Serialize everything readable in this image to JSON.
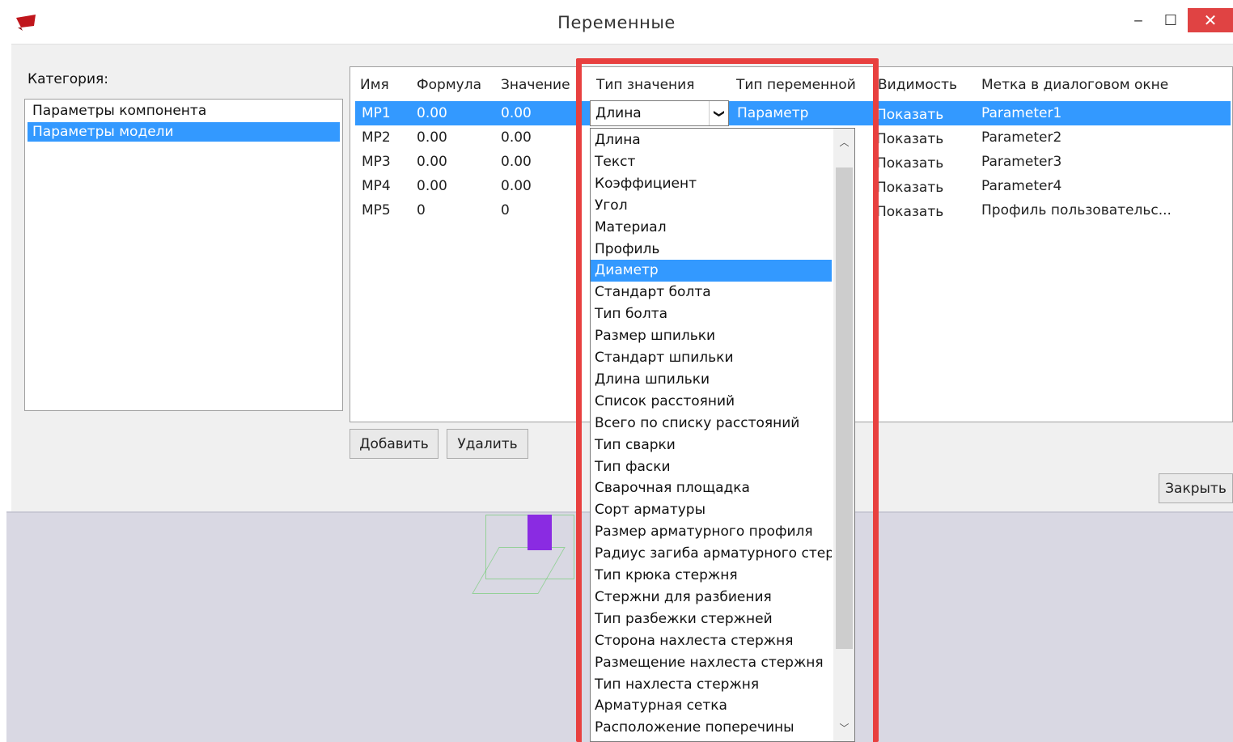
{
  "window": {
    "title": "Переменные",
    "minimize": "‒",
    "maximize": "☐",
    "close": "✕"
  },
  "category": {
    "label": "Категория:",
    "items": [
      "Параметры компонента",
      "Параметры модели"
    ],
    "selected_index": 1
  },
  "grid": {
    "headers": [
      "Имя",
      "Формула",
      "Значение",
      "Тип значения",
      "Тип переменной",
      "Видимость",
      "Метка в диалоговом окне"
    ],
    "rows": [
      {
        "name": "MP1",
        "formula": "0.00",
        "value": "0.00",
        "value_type": "Длина",
        "var_type": "Параметр",
        "visibility": "Показать",
        "label": "Parameter1"
      },
      {
        "name": "MP2",
        "formula": "0.00",
        "value": "0.00",
        "visibility": "Показать",
        "label": "Parameter2"
      },
      {
        "name": "MP3",
        "formula": "0.00",
        "value": "0.00",
        "visibility": "Показать",
        "label": "Parameter3"
      },
      {
        "name": "MP4",
        "formula": "0.00",
        "value": "0.00",
        "visibility": "Показать",
        "label": "Parameter4"
      },
      {
        "name": "MP5",
        "formula": "0",
        "value": "0",
        "visibility": "Показать",
        "label": "Профиль пользовательс..."
      }
    ]
  },
  "buttons": {
    "add": "Добавить",
    "delete": "Удалить",
    "close": "Закрыть"
  },
  "combo": {
    "value": "Длина",
    "arrow": "❯"
  },
  "dropdown": {
    "items": [
      "Длина",
      "Текст",
      "Коэффициент",
      "Угол",
      "Материал",
      "Профиль",
      "Диаметр",
      "Стандарт болта",
      "Тип болта",
      "Размер шпильки",
      "Стандарт шпильки",
      "Длина шпильки",
      "Список расстояний",
      "Всего по списку расстояний",
      "Тип сварки",
      "Тип фаски",
      "Сварочная площадка",
      "Сорт арматуры",
      "Размер арматурного профиля",
      "Радиус загиба арматурного стерж",
      "Тип крюка стержня",
      "Стержни для разбиения",
      "Тип разбежки стержней",
      "Сторона нахлеста стержня",
      "Размещение нахлеста стержня",
      "Тип нахлеста стержня",
      "Арматурная сетка",
      "Расположение поперечины"
    ],
    "selected_index": 6,
    "scroll_up": "︿",
    "scroll_down": "﹀"
  },
  "colors": {
    "selection": "#3399ff",
    "highlight_frame": "#e8403f",
    "close_button": "#e04343"
  }
}
